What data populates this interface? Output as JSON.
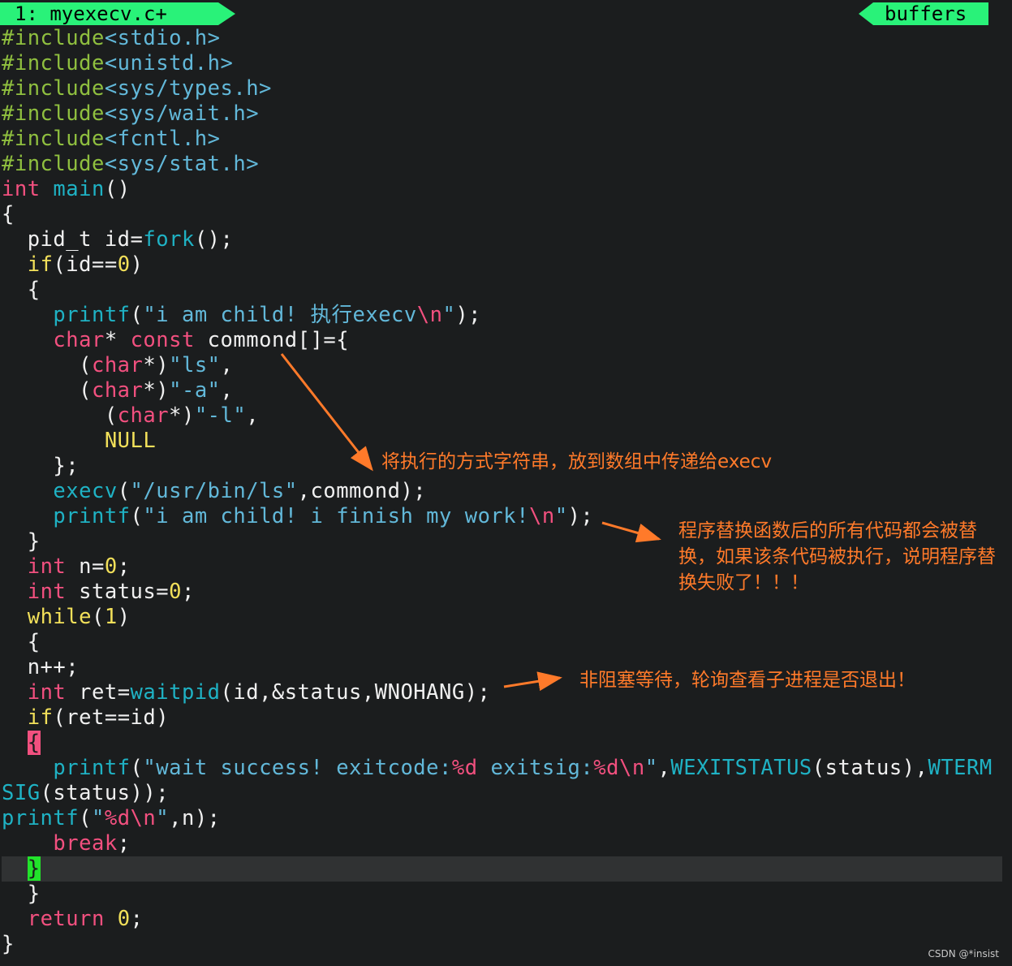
{
  "tabline": {
    "file_tab": "1: myexecv.c+",
    "buffers_label": "buffers",
    "accent_color": "#29f279"
  },
  "code_lines": [
    [
      [
        "c-pp",
        "#include"
      ],
      [
        "c-hdr",
        "<stdio.h>"
      ]
    ],
    [
      [
        "c-pp",
        "#include"
      ],
      [
        "c-hdr",
        "<unistd.h>"
      ]
    ],
    [
      [
        "c-pp",
        "#include"
      ],
      [
        "c-hdr",
        "<sys/types.h>"
      ]
    ],
    [
      [
        "c-pp",
        "#include"
      ],
      [
        "c-hdr",
        "<sys/wait.h>"
      ]
    ],
    [
      [
        "c-pp",
        "#include"
      ],
      [
        "c-hdr",
        "<fcntl.h>"
      ]
    ],
    [
      [
        "c-pp",
        "#include"
      ],
      [
        "c-hdr",
        "<sys/stat.h>"
      ]
    ],
    [
      [
        "c-kw",
        "int"
      ],
      [
        "c-txt",
        " "
      ],
      [
        "c-fn",
        "main"
      ],
      [
        "c-txt",
        "()"
      ]
    ],
    [
      [
        "c-txt",
        "{"
      ]
    ],
    [
      [
        "c-txt",
        "  pid_t id="
      ],
      [
        "c-fn",
        "fork"
      ],
      [
        "c-txt",
        "();"
      ]
    ],
    [
      [
        "c-txt",
        "  "
      ],
      [
        "c-num",
        "if"
      ],
      [
        "c-txt",
        "(id=="
      ],
      [
        "c-num",
        "0"
      ],
      [
        "c-txt",
        ")"
      ]
    ],
    [
      [
        "c-txt",
        "  {"
      ]
    ],
    [
      [
        "c-txt",
        "    "
      ],
      [
        "c-fn",
        "printf"
      ],
      [
        "c-txt",
        "("
      ],
      [
        "c-str",
        "\"i am child! 执行execv"
      ],
      [
        "c-esc",
        "\\n"
      ],
      [
        "c-str",
        "\""
      ],
      [
        "c-txt",
        ");"
      ]
    ],
    [
      [
        "c-txt",
        "    "
      ],
      [
        "c-kw",
        "char"
      ],
      [
        "c-txt",
        "* "
      ],
      [
        "c-kw",
        "const"
      ],
      [
        "c-txt",
        " commond[]={"
      ]
    ],
    [
      [
        "c-txt",
        "      ("
      ],
      [
        "c-kw",
        "char"
      ],
      [
        "c-txt",
        "*)"
      ],
      [
        "c-str",
        "\"ls\""
      ],
      [
        "c-txt",
        ","
      ]
    ],
    [
      [
        "c-txt",
        "      ("
      ],
      [
        "c-kw",
        "char"
      ],
      [
        "c-txt",
        "*)"
      ],
      [
        "c-str",
        "\"-a\""
      ],
      [
        "c-txt",
        ","
      ]
    ],
    [
      [
        "c-txt",
        "        ("
      ],
      [
        "c-kw",
        "char"
      ],
      [
        "c-txt",
        "*)"
      ],
      [
        "c-str",
        "\"-l\""
      ],
      [
        "c-txt",
        ","
      ]
    ],
    [
      [
        "c-txt",
        "        "
      ],
      [
        "c-num",
        "NULL"
      ]
    ],
    [
      [
        "c-txt",
        "    };"
      ]
    ],
    [
      [
        "c-txt",
        "    "
      ],
      [
        "c-fn",
        "execv"
      ],
      [
        "c-txt",
        "("
      ],
      [
        "c-str",
        "\"/usr/bin/ls\""
      ],
      [
        "c-txt",
        ",commond);"
      ]
    ],
    [
      [
        "c-txt",
        "    "
      ],
      [
        "c-fn",
        "printf"
      ],
      [
        "c-txt",
        "("
      ],
      [
        "c-str",
        "\"i am child! i finish my work!"
      ],
      [
        "c-esc",
        "\\n"
      ],
      [
        "c-str",
        "\""
      ],
      [
        "c-txt",
        ");"
      ]
    ],
    [
      [
        "c-txt",
        "  }"
      ]
    ],
    [
      [
        "c-txt",
        "  "
      ],
      [
        "c-kw",
        "int"
      ],
      [
        "c-txt",
        " n="
      ],
      [
        "c-num",
        "0"
      ],
      [
        "c-txt",
        ";"
      ]
    ],
    [
      [
        "c-txt",
        "  "
      ],
      [
        "c-kw",
        "int"
      ],
      [
        "c-txt",
        " status="
      ],
      [
        "c-num",
        "0"
      ],
      [
        "c-txt",
        ";"
      ]
    ],
    [
      [
        "c-txt",
        "  "
      ],
      [
        "c-num",
        "while"
      ],
      [
        "c-txt",
        "("
      ],
      [
        "c-num",
        "1"
      ],
      [
        "c-txt",
        ")"
      ]
    ],
    [
      [
        "c-txt",
        "  {"
      ]
    ],
    [
      [
        "c-txt",
        "  n++;"
      ]
    ],
    [
      [
        "c-txt",
        "  "
      ],
      [
        "c-kw",
        "int"
      ],
      [
        "c-txt",
        " ret="
      ],
      [
        "c-fn",
        "waitpid"
      ],
      [
        "c-txt",
        "(id,&status,WNOHANG);"
      ]
    ],
    [
      [
        "c-txt",
        "  "
      ],
      [
        "c-num",
        "if"
      ],
      [
        "c-txt",
        "(ret==id)"
      ]
    ],
    [
      [
        "c-txt",
        "  "
      ],
      [
        "c-cur-red",
        "{"
      ]
    ],
    [
      [
        "c-txt",
        "    "
      ],
      [
        "c-fn",
        "printf"
      ],
      [
        "c-txt",
        "("
      ],
      [
        "c-str",
        "\"wait success! exitcode:"
      ],
      [
        "c-esc",
        "%d"
      ],
      [
        "c-str",
        " exitsig:"
      ],
      [
        "c-esc",
        "%d\\n"
      ],
      [
        "c-str",
        "\""
      ],
      [
        "c-txt",
        ","
      ],
      [
        "c-fn",
        "WEXITSTATUS"
      ],
      [
        "c-txt",
        "(status),"
      ],
      [
        "c-fn",
        "WTERM"
      ]
    ],
    [
      [
        "c-fn",
        "SIG"
      ],
      [
        "c-txt",
        "(status));"
      ]
    ],
    [
      [
        "c-fn",
        "printf"
      ],
      [
        "c-txt",
        "("
      ],
      [
        "c-str",
        "\""
      ],
      [
        "c-esc",
        "%d\\n"
      ],
      [
        "c-str",
        "\""
      ],
      [
        "c-txt",
        ",n);"
      ]
    ],
    [
      [
        "c-txt",
        "    "
      ],
      [
        "c-kw",
        "break"
      ],
      [
        "c-txt",
        ";"
      ]
    ],
    [
      [
        "c-txt",
        "  "
      ],
      [
        "c-cur-grn",
        "}"
      ]
    ],
    [
      [
        "c-txt",
        "  }"
      ]
    ],
    [
      [
        "c-txt",
        "  "
      ],
      [
        "c-kw",
        "return"
      ],
      [
        "c-txt",
        " "
      ],
      [
        "c-num",
        "0"
      ],
      [
        "c-txt",
        ";"
      ]
    ],
    [
      [
        "c-txt",
        "}"
      ]
    ]
  ],
  "cursor_line_index": 33,
  "annotations": {
    "note1": "将执行的方式字符串，放到数组中传递给execv",
    "note2": "程序替换函数后的所有代码都会被替换，如果该条代码被执行，说明程序替换失败了！！！",
    "note3": "非阻塞等待，轮询查看子进程是否退出！",
    "arrow_color": "#ff7a2a"
  },
  "watermark": "CSDN @*insist"
}
